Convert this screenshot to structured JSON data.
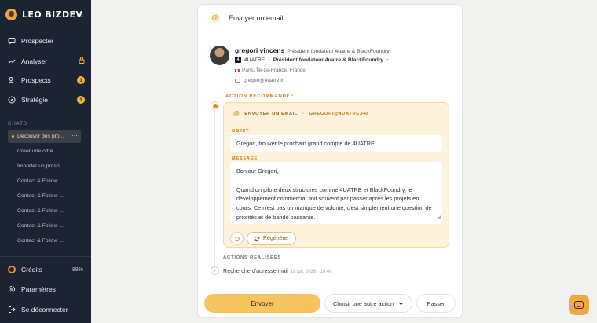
{
  "sidebar": {
    "brand": "LEO BIZDEV",
    "collapse_glyph": "‹",
    "nav": [
      {
        "label": "Prospecter",
        "icon": "prospect-icon"
      },
      {
        "label": "Analyser",
        "icon": "chart-trend-icon",
        "locked": true
      },
      {
        "label": "Prospects",
        "icon": "users-icon",
        "badge": "1"
      },
      {
        "label": "Stratégie",
        "icon": "compass-icon",
        "badge": "1"
      }
    ],
    "chats_label": "CHATS",
    "chats": [
      "Découvrir des pro...",
      "Créer une offre",
      "Importer un prosp...",
      "Contact & Follow ...",
      "Contact & Follow ...",
      "Contact & Follow ...",
      "Contact & Follow ...",
      "Contact & Follow ..."
    ],
    "credits_label": "Crédits",
    "credits_value": "88%",
    "settings_label": "Paramètres",
    "logout_label": "Se déconnecter"
  },
  "card": {
    "title": "Envoyer un email",
    "contact": {
      "name": "gregori vincens",
      "role": "Président fondateur 4uatre & BlackFoundry",
      "company": "4UATRE",
      "company_role": "Président fondateur 4uatre & BlackFoundry",
      "location": "Paris, Île-de-France, France",
      "email": "gregori@4uatre.fr"
    },
    "recommended_label": "ACTION RECOMMANDÉE",
    "action_type": "ENVOYER UN EMAIL",
    "action_target": "GREGORI@4UATRE.FR",
    "subject_label": "OBJET",
    "subject": "Gregori, trouver le prochain grand compte de 4UATRE",
    "message_label": "MESSAGE",
    "message": "Bonjour Gregori,\n\nQuand on pilote deux structures comme 4UATRE et BlackFoundry, le développement commercial finit souvent par passer après les projets en cours. Ce n'est pas un manque de volonté, c'est simplement une question de priorités et de bande passante.",
    "regenerate_label": "Régénérer",
    "done_label": "ACTIONS RÉALISÉES",
    "done_item": "Recherche d'adresse mail",
    "done_time": "18 juil. 2026 · 10:40",
    "send_label": "Envoyer",
    "choose_label": "Choisir une autre action",
    "pass_label": "Passer"
  },
  "colors": {
    "sidebar_bg": "#1c2331",
    "accent": "#f0b43c",
    "recommend_bg": "#fdf3dc"
  }
}
